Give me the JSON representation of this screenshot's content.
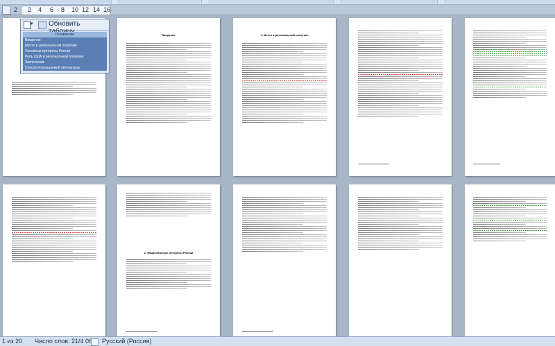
{
  "ruler": {
    "ticks": [
      "2",
      "2",
      "4",
      "6",
      "8",
      "10",
      "12",
      "14",
      "16"
    ]
  },
  "nav_pane": {
    "update_label": "Обновить таблицу...",
    "items": [
      "Оглавление",
      "Введение",
      "Место в региональной политике",
      "Основные интересы России",
      "Роль США в региональной политике",
      "Заключение",
      "Список используемой литературы"
    ]
  },
  "pages": {
    "top": [
      {
        "title": ""
      },
      {
        "title": "Введение"
      },
      {
        "title": "1. Место в региональной политике"
      },
      {
        "title": ""
      },
      {
        "title": ""
      }
    ],
    "bottom": [
      {
        "title": ""
      },
      {
        "title": "2. Национальные интересы России"
      },
      {
        "title": ""
      },
      {
        "title": ""
      },
      {
        "title": ""
      }
    ]
  },
  "status": {
    "page": "1 из 20",
    "words": "Число слов: 21/4 065",
    "language": "Русский (Россия)"
  }
}
